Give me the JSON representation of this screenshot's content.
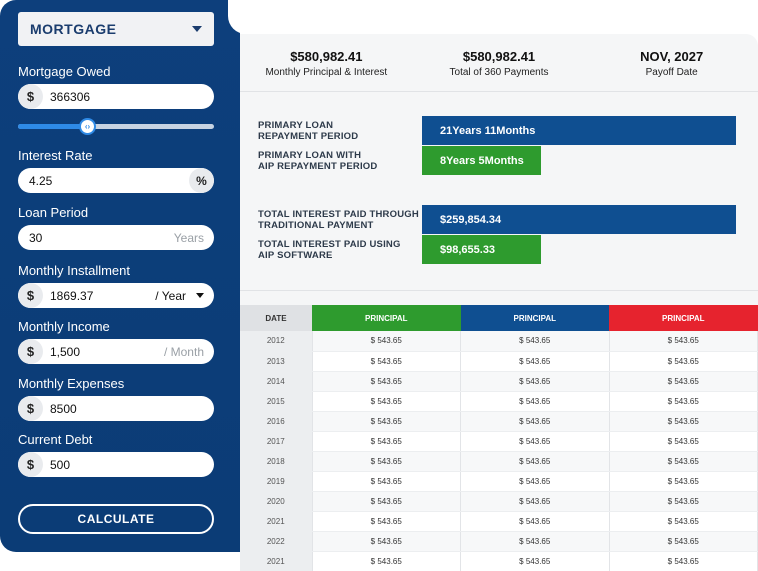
{
  "calculator": {
    "type_select": "MORTGAGE",
    "mortgage_owed": {
      "label": "Mortgage Owed",
      "prefix": "$",
      "value": "366306",
      "slider_fraction": 0.35
    },
    "interest_rate": {
      "label": "Interest Rate",
      "value": "4.25",
      "suffix": "%"
    },
    "loan_period": {
      "label": "Loan Period",
      "value": "30",
      "suffix": "Years"
    },
    "monthly_installment": {
      "label": "Monthly Installment",
      "prefix": "$",
      "value": "1869.37",
      "period": "/ Year"
    },
    "monthly_income": {
      "label": "Monthly Income",
      "prefix": "$",
      "value": "1,500",
      "suffix": "/ Month"
    },
    "monthly_expenses": {
      "label": "Monthly Expenses",
      "prefix": "$",
      "value": "8500"
    },
    "current_debt": {
      "label": "Current Debt",
      "prefix": "$",
      "value": "500"
    },
    "calculate_label": "CALCULATE"
  },
  "summary": [
    {
      "value": "$580,982.41",
      "caption": "Monthly Principal & Interest"
    },
    {
      "value": "$580,982.41",
      "caption": "Total of 360 Payments"
    },
    {
      "value": "NOV, 2027",
      "caption": "Payoff Date"
    }
  ],
  "comparisons": [
    {
      "label_line1": "PRIMARY LOAN",
      "label_line2": "REPAYMENT PERIOD",
      "bar_text": "21Years 11Months",
      "color": "#0f4f91",
      "fraction": 1.0
    },
    {
      "label_line1": "PRIMARY LOAN WITH",
      "label_line2": "AIP REPAYMENT PERIOD",
      "bar_text": "8Years 5Months",
      "color": "#2e9b2e",
      "fraction": 0.38
    },
    {
      "label_line1": "TOTAL INTEREST PAID THROUGH",
      "label_line2": "TRADITIONAL PAYMENT",
      "bar_text": "$259,854.34",
      "color": "#0f4f91",
      "fraction": 1.0
    },
    {
      "label_line1": "TOTAL INTEREST PAID USING",
      "label_line2": "AIP SOFTWARE",
      "bar_text": "$98,655.33",
      "color": "#2e9b2e",
      "fraction": 0.38
    }
  ],
  "table": {
    "headers": [
      {
        "label": "DATE",
        "color": "#dfe1e4"
      },
      {
        "label": "PRINCIPAL",
        "color": "#2e9b2e"
      },
      {
        "label": "PRINCIPAL",
        "color": "#0f4f91"
      },
      {
        "label": "PRINCIPAL",
        "color": "#e6232e"
      }
    ],
    "rows": [
      [
        "2012",
        "$ 543.65",
        "$ 543.65",
        "$ 543.65"
      ],
      [
        "2013",
        "$ 543.65",
        "$ 543.65",
        "$ 543.65"
      ],
      [
        "2014",
        "$ 543.65",
        "$ 543.65",
        "$ 543.65"
      ],
      [
        "2015",
        "$ 543.65",
        "$ 543.65",
        "$ 543.65"
      ],
      [
        "2016",
        "$ 543.65",
        "$ 543.65",
        "$ 543.65"
      ],
      [
        "2017",
        "$ 543.65",
        "$ 543.65",
        "$ 543.65"
      ],
      [
        "2018",
        "$ 543.65",
        "$ 543.65",
        "$ 543.65"
      ],
      [
        "2019",
        "$ 543.65",
        "$ 543.65",
        "$ 543.65"
      ],
      [
        "2020",
        "$ 543.65",
        "$ 543.65",
        "$ 543.65"
      ],
      [
        "2021",
        "$ 543.65",
        "$ 543.65",
        "$ 543.65"
      ],
      [
        "2022",
        "$ 543.65",
        "$ 543.65",
        "$ 543.65"
      ],
      [
        "2021",
        "$ 543.65",
        "$ 543.65",
        "$ 543.65"
      ]
    ]
  }
}
